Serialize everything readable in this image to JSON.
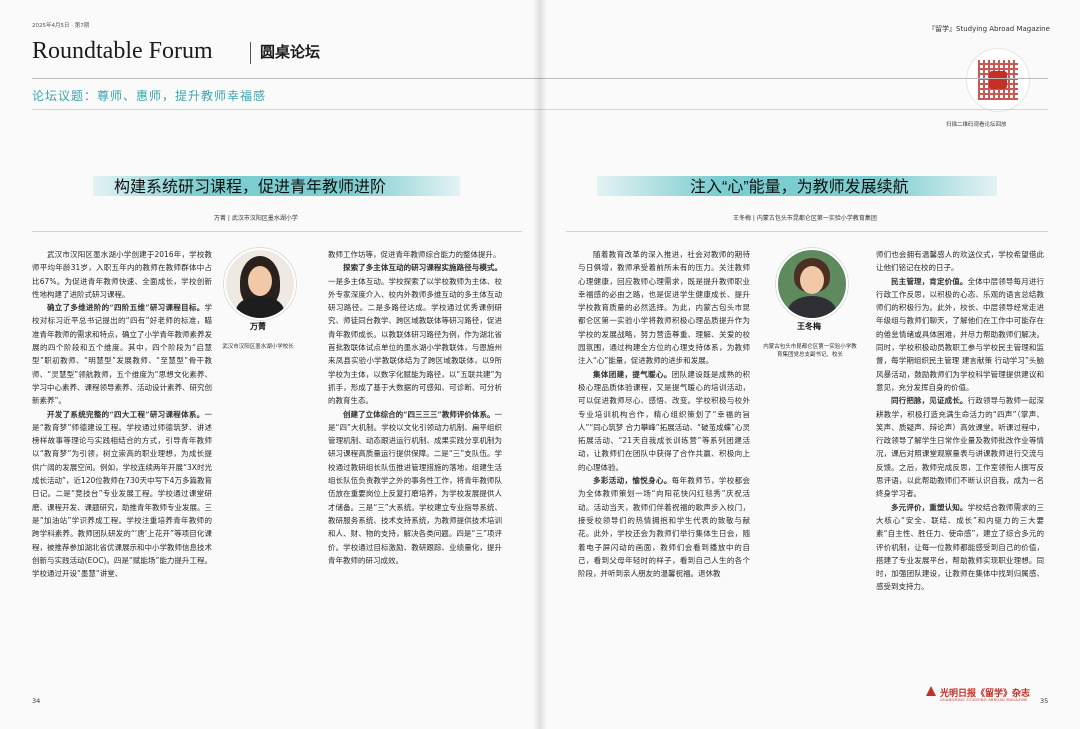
{
  "header": {
    "issue": "2025年4月5日 · 第7期",
    "forum_en": "Roundtable Forum",
    "forum_cn": "圆桌论坛",
    "topic": "论坛议题：尊师、惠师，提升教师幸福感",
    "magazine": "『留学』Studying Abroad Magazine",
    "scan_text": "扫描二维码观看论坛回放"
  },
  "left_article": {
    "title": "构建系统研习课程，促进青年教师进阶",
    "byline": "万菁 | 武汉市汉阳区墨水湖小学",
    "person_name": "万菁",
    "person_title": "武汉市汉阳区墨水湖小学校长",
    "col1": [
      {
        "lead": "",
        "text": "武汉市汉阳区墨水湖小学创建于2016年，学校教师平均年龄31岁，入职五年内的教师在教师群体中占比67%。为促进青年教师快速、全面成长，学校创新性地构建了进阶式研习课程。"
      },
      {
        "lead": "确立了多维进阶的“四阶五维”研习课程目标。",
        "text": "学校对标习近平总书记提出的“四有”好老师的标准，瞄准青年教师的需求和特点，确立了小学青年教师素养发展的四个阶段和五个维度。其中，四个阶段为“启慧型”职初教师、“明慧型”发展教师、“至慧型”骨干教师、“灵慧型”领航教师，五个维度为“思想文化素养、学习中心素养、课程领导素养、活动设计素养、研究创新素养”。"
      },
      {
        "lead": "开发了系统完整的“四大工程”研习课程体系。",
        "text": "一是“教育梦”师德建设工程。学校通过师德筑梦、讲述榜样故事等理论与实践相结合的方式，引导青年教师以“教育梦”为引领，树立崇高的职业理想，为成长提供广阔的发展空间。例如，学校连续两年开展“3X时光成长活动”，近120位教师在730天中写下4万多篇教育日记。二是“竞技台”专业发展工程。学校通过课堂研磨、课程开发、课题研究，助推青年教师专业发展。三是“加油站”学识养成工程。学校注重培养青年教师的跨学科素养。教师团队研发的“‘唐’上花开”等项目化课程，被推荐参加湖北省优课展示和中小学教师信息技术创新与实践活动(EOC)。四是“赋能场”能力提升工程。学校通过开设“墨慧”讲堂、"
      }
    ],
    "col2": [
      {
        "lead": "",
        "text": "教师工作坊等，促进青年教师综合能力的整体提升。"
      },
      {
        "lead": "探索了多主体互动的研习课程实施路径与模式。",
        "text": "一是多主体互动。学校探索了以学校教师为主体、校外专家深度介入、校内外教师多维互动的多主体互动研习路径。二是多路径达成。学校通过优秀课例研究、师徒同台教学、跨区域教联体等研习路径，促进青年教师成长。以教联体研习路径为例，作为湖北省首批教联体试点单位的墨水湖小学教联体，与恩施州来凤县实验小学教联体结为了跨区域教联体，以9所学校为主体，以数字化赋能为路径，以“五联共建”为抓手，形成了基于大数据的可感知、可诊断、可分析的教育生态。"
      },
      {
        "lead": "创建了立体综合的“四三三三”教师评价体系。",
        "text": "一是“四”大机制。学校以文化引领动力机制、扁平组织管理机制、动态跟进运行机制、成果实践分享机制为研习课程高质量运行提供保障。二是“三”支队伍。学校通过教研组长队伍推进管理措施的落地，组建生活组长队伍负责教学之外的事务性工作，将青年教师队伍放在重要岗位上反复打磨培养，为学校发展提供人才储备。三是“三”大系统。学校建立专业指导系统、教研服务系统、技术支持系统，为教师提供技术培训和人、财、物的支持，解决各类问题。四是“三”项评价。学校通过目标激励、教研跟踪、业绩量化，提升青年教师的研习成效。"
      }
    ]
  },
  "right_article": {
    "title": "注入“心”能量，为教师发展续航",
    "byline": "王冬梅 | 内蒙古包头市昆都仑区第一实验小学教育集团",
    "person_name": "王冬梅",
    "person_title": "内蒙古包头市昆都仑区第一实验小学教育集团党总支副书记、校长",
    "col1": [
      {
        "lead": "",
        "text": "随着教育改革的深入推进，社会对教师的期待与日俱增，教师承受着前所未有的压力。关注教师心理健康，回应教师心理需求，既是提升教师职业幸福感的必由之路，也是促进学生健康成长、提升学校教育质量的必然选择。为此，内蒙古包头市昆都仑区第一实验小学将教师积极心理品质提升作为学校的发展战略，努力营造尊重、理解、关爱的校园氛围，通过构建全方位的心理支持体系，为教师注入“心”能量，促进教师的进步和发展。"
      },
      {
        "lead": "集体团建，提气暖心。",
        "text": "团队建设既是成熟的积极心理品质体验课程，又是提气暖心的培训活动，可以促进教师尽心、感悟、改变。学校积极与校外专业培训机构合作，精心组织策划了“幸福的旨人”“同心筑梦 合力攀峰”拓展活动、“破茧成蝶”心灵拓展活动、“21天自我成长训练营”等系列团建活动，让教师们在团队中获得了合作共赢、积极向上的心理体验。"
      },
      {
        "lead": "多彩活动，愉悦身心。",
        "text": "每年教师节，学校都会为全体教师策划一场“向阳花快闪红毯秀”庆祝活动。活动当天，教师们伴着祝福的歌声步入校门，接受校领导们的热情拥抱和学生代表的致敬与献花。此外，学校还会为教师们举行集体生日会，随着电子屏闪动的画面，教师们会看到播放中的自己，看到父母年轻时的样子，看到自己人生的各个阶段，并听到亲人朋友的温馨祝福。退休教"
      }
    ],
    "col2": [
      {
        "lead": "",
        "text": "师们也会拥有温馨感人的欢送仪式，学校希望借此让他们铭记在校的日子。"
      },
      {
        "lead": "民主管理，肯定价值。",
        "text": "全体中层领导每月进行行政工作反思，以积极的心态、乐观的语言总结教师们的积极行为。此外，校长、中层领导经常走进年级组与教师们聊天，了解他们在工作中可能存在的倦怠情绪或具体困难，并尽力帮助教师们解决。同时，学校积极动员教职工参与学校民主管理和监督，每学期组织民主管理 建言献策 行动学习”头脑风暴活动，鼓励教师们为学校科学管理提供建议和意见，充分发挥自身的价值。"
      },
      {
        "lead": "同行把脉，见证成长。",
        "text": "行政领导与教师一起深耕教学，积极打造充满生命活力的“四声”（掌声、笑声、质疑声、辩论声）高效课堂。听课过程中，行政领导了解学生日常作业量及教师批改作业等情况，课后对照课堂观察量表与讲课教师进行交流与反馈。之后，教师完成反思，工作室领衔人撰写反思评语，以此帮助教师们不断认识自我，成为一名终身学习者。"
      },
      {
        "lead": "多元评价，重塑认知。",
        "text": "学校结合教师需求的三大核心“安全、联结、成长”和内驱力的三大要素“自主性、胜任力、使命感”，建立了综合多元的评价机制，让每一位教师都能感受到自己的价值，搭建了专业发展平台，帮助教师实现职业理想。同时，加强团队建设，让教师在集体中找到归属感、感受到支持力。"
      }
    ]
  },
  "footer": {
    "left_page": "34",
    "right_page": "35",
    "logo_text": "光明日报《留学》杂志",
    "logo_sub": "GUANGMING STUDYING ABROAD MAGAZINE"
  }
}
